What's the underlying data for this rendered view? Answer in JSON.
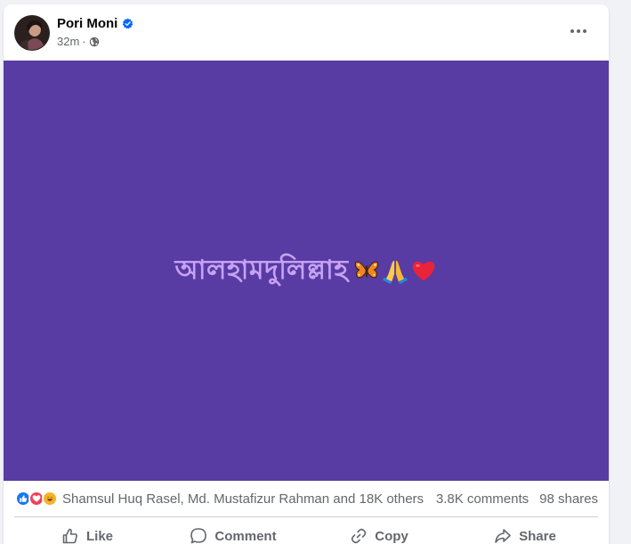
{
  "post": {
    "author": "Pori Moni",
    "time": "32m",
    "separator": "·",
    "verified": true,
    "privacy_icon": "globe-icon",
    "background_color": "#583ca3",
    "text": "আলহামদুলিল্লাহ",
    "text_color": "#c7a2f5",
    "emojis": [
      "butterfly",
      "folded-hands",
      "red-heart"
    ]
  },
  "reactions": {
    "icons": [
      "like",
      "love",
      "haha"
    ],
    "summary": "Shamsul Huq Rasel, Md. Mustafizur Rahman and 18K others",
    "comments": "3.8K comments",
    "shares": "98 shares"
  },
  "actions": {
    "like": "Like",
    "comment": "Comment",
    "copy": "Copy",
    "share": "Share"
  },
  "colors": {
    "accent": "#1877f2",
    "secondary_text": "#65676b"
  }
}
